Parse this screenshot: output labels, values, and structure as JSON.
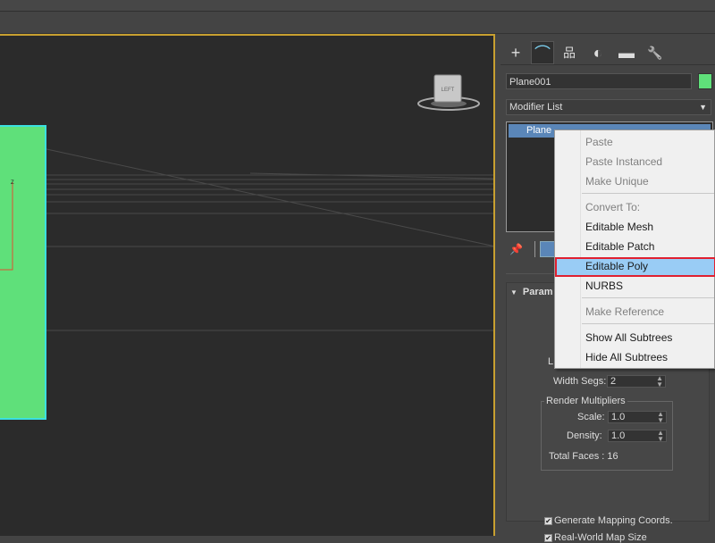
{
  "viewport": {
    "viewcube_label": "LEFT",
    "colors": {
      "plane": "#5fe07a",
      "selection": "#3ae0e0",
      "active_border": "#c8a030"
    }
  },
  "command_panel": {
    "tabs": [
      {
        "name": "create",
        "icon": "plus-icon",
        "glyph": "+"
      },
      {
        "name": "modify",
        "icon": "modify-curve-icon",
        "glyph": "⌒"
      },
      {
        "name": "hierarchy",
        "icon": "hierarchy-icon",
        "glyph": "品"
      },
      {
        "name": "motion",
        "icon": "motion-icon",
        "glyph": "◐"
      },
      {
        "name": "display",
        "icon": "display-monitor-icon",
        "glyph": "▬"
      },
      {
        "name": "utilities",
        "icon": "wrench-icon",
        "glyph": "🔧"
      }
    ],
    "object_name": "Plane001",
    "object_color": "#5fe07a",
    "modifier_list_label": "Modifier List",
    "stack_items": [
      "Plane"
    ],
    "rollout": {
      "title": "Param",
      "length_label_partial": "L",
      "width_segs_label": "Width Segs:",
      "width_segs_value": "2",
      "render_multipliers_title": "Render Multipliers",
      "scale_label": "Scale:",
      "scale_value": "1.0",
      "density_label": "Density:",
      "density_value": "1.0",
      "total_faces_label": "Total Faces : 16",
      "generate_mapping_label": "Generate Mapping Coords.",
      "generate_mapping_checked": true,
      "real_world_label": "Real-World Map Size",
      "real_world_checked": true
    }
  },
  "context_menu": {
    "items": [
      {
        "label": "Paste",
        "disabled": true
      },
      {
        "label": "Paste Instanced",
        "disabled": true
      },
      {
        "label": "Make Unique",
        "disabled": true
      },
      {
        "label": "Convert To:",
        "disabled": true
      },
      {
        "label": "Editable Mesh",
        "disabled": false
      },
      {
        "label": "Editable Patch",
        "disabled": false
      },
      {
        "label": "Editable Poly",
        "disabled": false,
        "highlighted": true
      },
      {
        "label": "NURBS",
        "disabled": false
      },
      {
        "label": "Make Reference",
        "disabled": true
      },
      {
        "label": "Show All Subtrees",
        "disabled": false
      },
      {
        "label": "Hide All Subtrees",
        "disabled": false
      }
    ]
  }
}
